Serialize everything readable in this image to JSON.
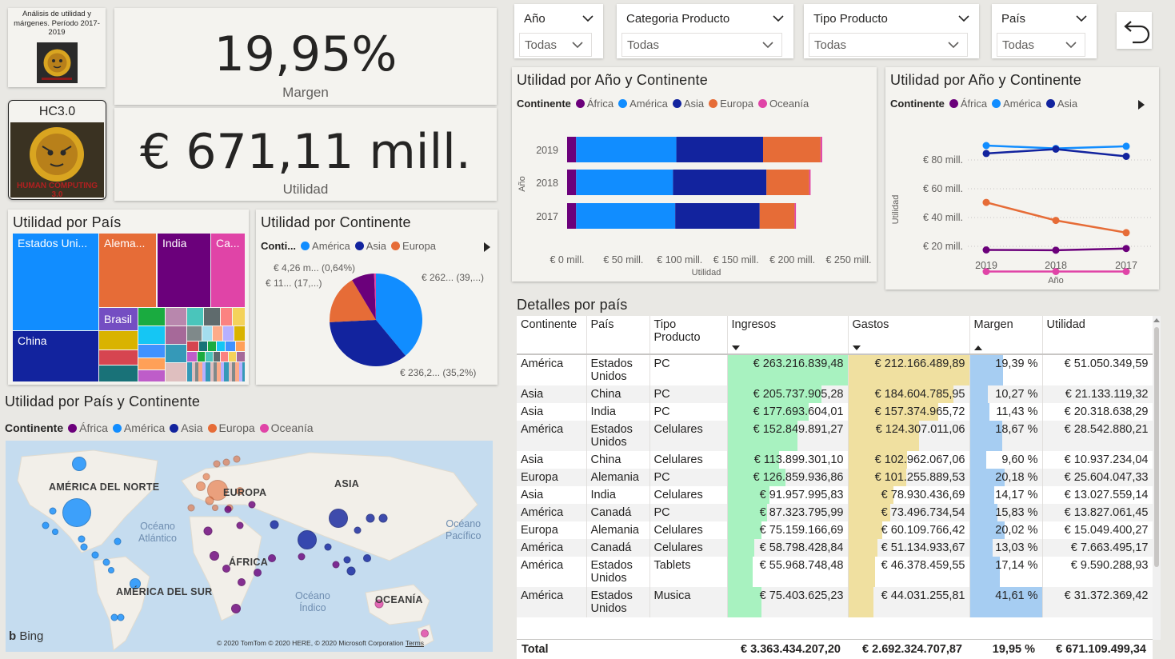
{
  "logo": {
    "title": "Análisis de utilidad y márgenes. Período 2017-2019",
    "hc_title": "HC3.0",
    "hc_text": "HUMAN COMPUTING 3.0"
  },
  "kpi": {
    "margin_value": "19,95%",
    "margin_label": "Margen",
    "profit_value": "€ 671,11 mill.",
    "profit_label": "Utilidad"
  },
  "slicers": [
    {
      "label": "Año",
      "value": "Todas"
    },
    {
      "label": "Categoria Producto",
      "value": "Todas"
    },
    {
      "label": "Tipo Producto",
      "value": "Todas"
    },
    {
      "label": "País",
      "value": "Todas"
    }
  ],
  "colors": {
    "africa": "#6b007b",
    "america": "#118dff",
    "asia": "#12239e",
    "europa": "#e66c37",
    "oceania": "#e044a7"
  },
  "treemap": {
    "title": "Utilidad por País",
    "labels": [
      "Estados Uni...",
      "Alema...",
      "India",
      "Ca...",
      "Brasil",
      "China"
    ]
  },
  "pie": {
    "title": "Utilidad por Continente",
    "legend_title": "Conti...",
    "legend": [
      "América",
      "Asia",
      "Europa"
    ],
    "labels": [
      "€ 4,26 m... (0,64%)",
      "€ 11... (17,...)",
      "€ 262... (39,...)",
      "€ 236,2... (35,2%)"
    ]
  },
  "bar_chart": {
    "title": "Utilidad por Año y Continente",
    "legend_title": "Continente",
    "legend": [
      "África",
      "América",
      "Asia",
      "Europa",
      "Oceanía"
    ],
    "y_title": "Año",
    "x_title": "Utilidad",
    "x_ticks": [
      "€ 0 mill.",
      "€ 50 mill.",
      "€ 100 mill.",
      "€ 150 mill.",
      "€ 200 mill.",
      "€ 250 mill."
    ]
  },
  "line_chart": {
    "title": "Utilidad por Año y Continente",
    "legend_title": "Continente",
    "legend": [
      "África",
      "América",
      "Asia"
    ],
    "y_title": "Utilidad",
    "x_title": "Año",
    "y_ticks": [
      "€ 80 mill.",
      "€ 60 mill.",
      "€ 40 mill.",
      "€ 20 mill."
    ]
  },
  "map": {
    "title": "Utilidad por País y Continente",
    "legend_title": "Continente",
    "legend": [
      "África",
      "América",
      "Asia",
      "Europa",
      "Oceanía"
    ],
    "labels": {
      "na": "AMÉRICA DEL NORTE",
      "eu": "EUROPA",
      "asia": "ASIA",
      "africa": "ÁFRICA",
      "sa": "AMÉRICA DEL SUR",
      "oceania": "OCEANÍA"
    },
    "oceans": {
      "atl1": "Océano",
      "atl2": "Atlántico",
      "pac1": "Océano",
      "pac2": "Pacífico",
      "ind1": "Océano",
      "ind2": "Índico"
    },
    "bing": "Bing",
    "copyright": "© 2020 TomTom © 2020 HERE, © 2020 Microsoft Corporation",
    "terms": "Terms"
  },
  "table": {
    "title": "Detalles por país",
    "headers": {
      "continente": "Continente",
      "pais": "País",
      "tipo1": "Tipo",
      "tipo2": "Producto",
      "ingresos": "Ingresos",
      "gastos": "Gastos",
      "margen": "Margen",
      "utilidad": "Utilidad"
    },
    "rows": [
      {
        "cont": "América",
        "pais1": "Estados",
        "pais2": "Unidos",
        "tipo": "PC",
        "ing": "€ 263.216.839,48",
        "gas": "€ 212.166.489,89",
        "mar": "19,39 %",
        "uti": "€ 51.050.349,59",
        "ing_f": 1.0,
        "gas_f": 1.0,
        "mar_f": 0.466
      },
      {
        "cont": "Asia",
        "pais1": "China",
        "pais2": "",
        "tipo": "PC",
        "ing": "€ 205.737.905,28",
        "gas": "€ 184.604.785,95",
        "mar": "10,27 %",
        "uti": "€ 21.133.119,32",
        "ing_f": 0.782,
        "gas_f": 0.87,
        "mar_f": 0.247
      },
      {
        "cont": "Asia",
        "pais1": "India",
        "pais2": "",
        "tipo": "PC",
        "ing": "€ 177.693.604,01",
        "gas": "€ 157.374.965,72",
        "mar": "11,43 %",
        "uti": "€ 20.318.638,29",
        "ing_f": 0.675,
        "gas_f": 0.742,
        "mar_f": 0.275
      },
      {
        "cont": "América",
        "pais1": "Estados",
        "pais2": "Unidos",
        "tipo": "Celulares",
        "ing": "€ 152.849.891,27",
        "gas": "€ 124.307.011,06",
        "mar": "18,67 %",
        "uti": "€ 28.542.880,21",
        "ing_f": 0.581,
        "gas_f": 0.586,
        "mar_f": 0.449
      },
      {
        "cont": "Asia",
        "pais1": "China",
        "pais2": "",
        "tipo": "Celulares",
        "ing": "€ 113.899.301,10",
        "gas": "€ 102.962.067,06",
        "mar": "9,60 %",
        "uti": "€ 10.937.234,04",
        "ing_f": 0.433,
        "gas_f": 0.485,
        "mar_f": 0.231
      },
      {
        "cont": "Europa",
        "pais1": "Alemania",
        "pais2": "",
        "tipo": "PC",
        "ing": "€ 126.859.936,86",
        "gas": "€ 101.255.889,53",
        "mar": "20,18 %",
        "uti": "€ 25.604.047,33",
        "ing_f": 0.482,
        "gas_f": 0.477,
        "mar_f": 0.485
      },
      {
        "cont": "Asia",
        "pais1": "India",
        "pais2": "",
        "tipo": "Celulares",
        "ing": "€ 91.957.995,83",
        "gas": "€ 78.930.436,69",
        "mar": "14,17 %",
        "uti": "€ 13.027.559,14",
        "ing_f": 0.349,
        "gas_f": 0.372,
        "mar_f": 0.341
      },
      {
        "cont": "América",
        "pais1": "Canadá",
        "pais2": "",
        "tipo": "PC",
        "ing": "€ 87.323.795,99",
        "gas": "€ 73.496.734,54",
        "mar": "15,83 %",
        "uti": "€ 13.827.061,45",
        "ing_f": 0.332,
        "gas_f": 0.346,
        "mar_f": 0.381
      },
      {
        "cont": "Europa",
        "pais1": "Alemania",
        "pais2": "",
        "tipo": "Celulares",
        "ing": "€ 75.159.166,69",
        "gas": "€ 60.109.766,42",
        "mar": "20,02 %",
        "uti": "€ 15.049.400,27",
        "ing_f": 0.286,
        "gas_f": 0.283,
        "mar_f": 0.481
      },
      {
        "cont": "América",
        "pais1": "Canadá",
        "pais2": "",
        "tipo": "Celulares",
        "ing": "€ 58.798.428,84",
        "gas": "€ 51.134.933,67",
        "mar": "13,03 %",
        "uti": "€ 7.663.495,17",
        "ing_f": 0.223,
        "gas_f": 0.241,
        "mar_f": 0.313
      },
      {
        "cont": "América",
        "pais1": "Estados",
        "pais2": "Unidos",
        "tipo": "Tablets",
        "ing": "€ 55.968.748,48",
        "gas": "€ 46.378.459,55",
        "mar": "17,14 %",
        "uti": "€ 9.590.288,93",
        "ing_f": 0.213,
        "gas_f": 0.219,
        "mar_f": 0.412
      },
      {
        "cont": "América",
        "pais1": "Estados",
        "pais2": "Unidos",
        "tipo": "Musica",
        "ing": "€ 75.403.625,23",
        "gas": "€ 44.031.255,81",
        "mar": "41,61 %",
        "uti": "€ 31.372.369,42",
        "ing_f": 0.286,
        "gas_f": 0.208,
        "mar_f": 1.0
      }
    ],
    "total": {
      "label": "Total",
      "ing": "€ 3.363.434.207,20",
      "gas": "€ 2.692.324.707,87",
      "mar": "19,95 %",
      "uti": "€ 671.109.499,34"
    }
  },
  "chart_data": [
    {
      "type": "bar",
      "title": "Utilidad por Año y Continente",
      "xlabel": "Utilidad",
      "ylabel": "Año",
      "stacked": true,
      "orientation": "horizontal",
      "categories": [
        "2019",
        "2018",
        "2017"
      ],
      "xlim": [
        0,
        250
      ],
      "series": [
        {
          "name": "África",
          "values": [
            8,
            8,
            8
          ]
        },
        {
          "name": "América",
          "values": [
            89,
            86,
            88
          ]
        },
        {
          "name": "Asia",
          "values": [
            77,
            83,
            75
          ]
        },
        {
          "name": "Europa",
          "values": [
            51,
            38,
            31
          ]
        },
        {
          "name": "Oceanía",
          "values": [
            1.5,
            1.2,
            1.2
          ]
        }
      ]
    },
    {
      "type": "line",
      "title": "Utilidad por Año y Continente",
      "xlabel": "Año",
      "ylabel": "Utilidad",
      "x": [
        "2019",
        "2018",
        "2017"
      ],
      "ylim": [
        0,
        95
      ],
      "series": [
        {
          "name": "África",
          "values": [
            17.5,
            17.3,
            18.5
          ]
        },
        {
          "name": "América",
          "values": [
            90,
            88,
            89.5
          ]
        },
        {
          "name": "Asia",
          "values": [
            84.5,
            87.5,
            82.5
          ]
        },
        {
          "name": "Europa",
          "values": [
            50.5,
            38,
            29.5
          ]
        },
        {
          "name": "Oceanía",
          "values": [
            2.5,
            2.5,
            2.5
          ]
        }
      ]
    },
    {
      "type": "pie",
      "title": "Utilidad por Continente",
      "categories": [
        "América",
        "Asia",
        "Europa",
        "África",
        "Oceanía"
      ],
      "values": [
        39.0,
        35.2,
        17.2,
        7.96,
        0.64
      ]
    }
  ]
}
